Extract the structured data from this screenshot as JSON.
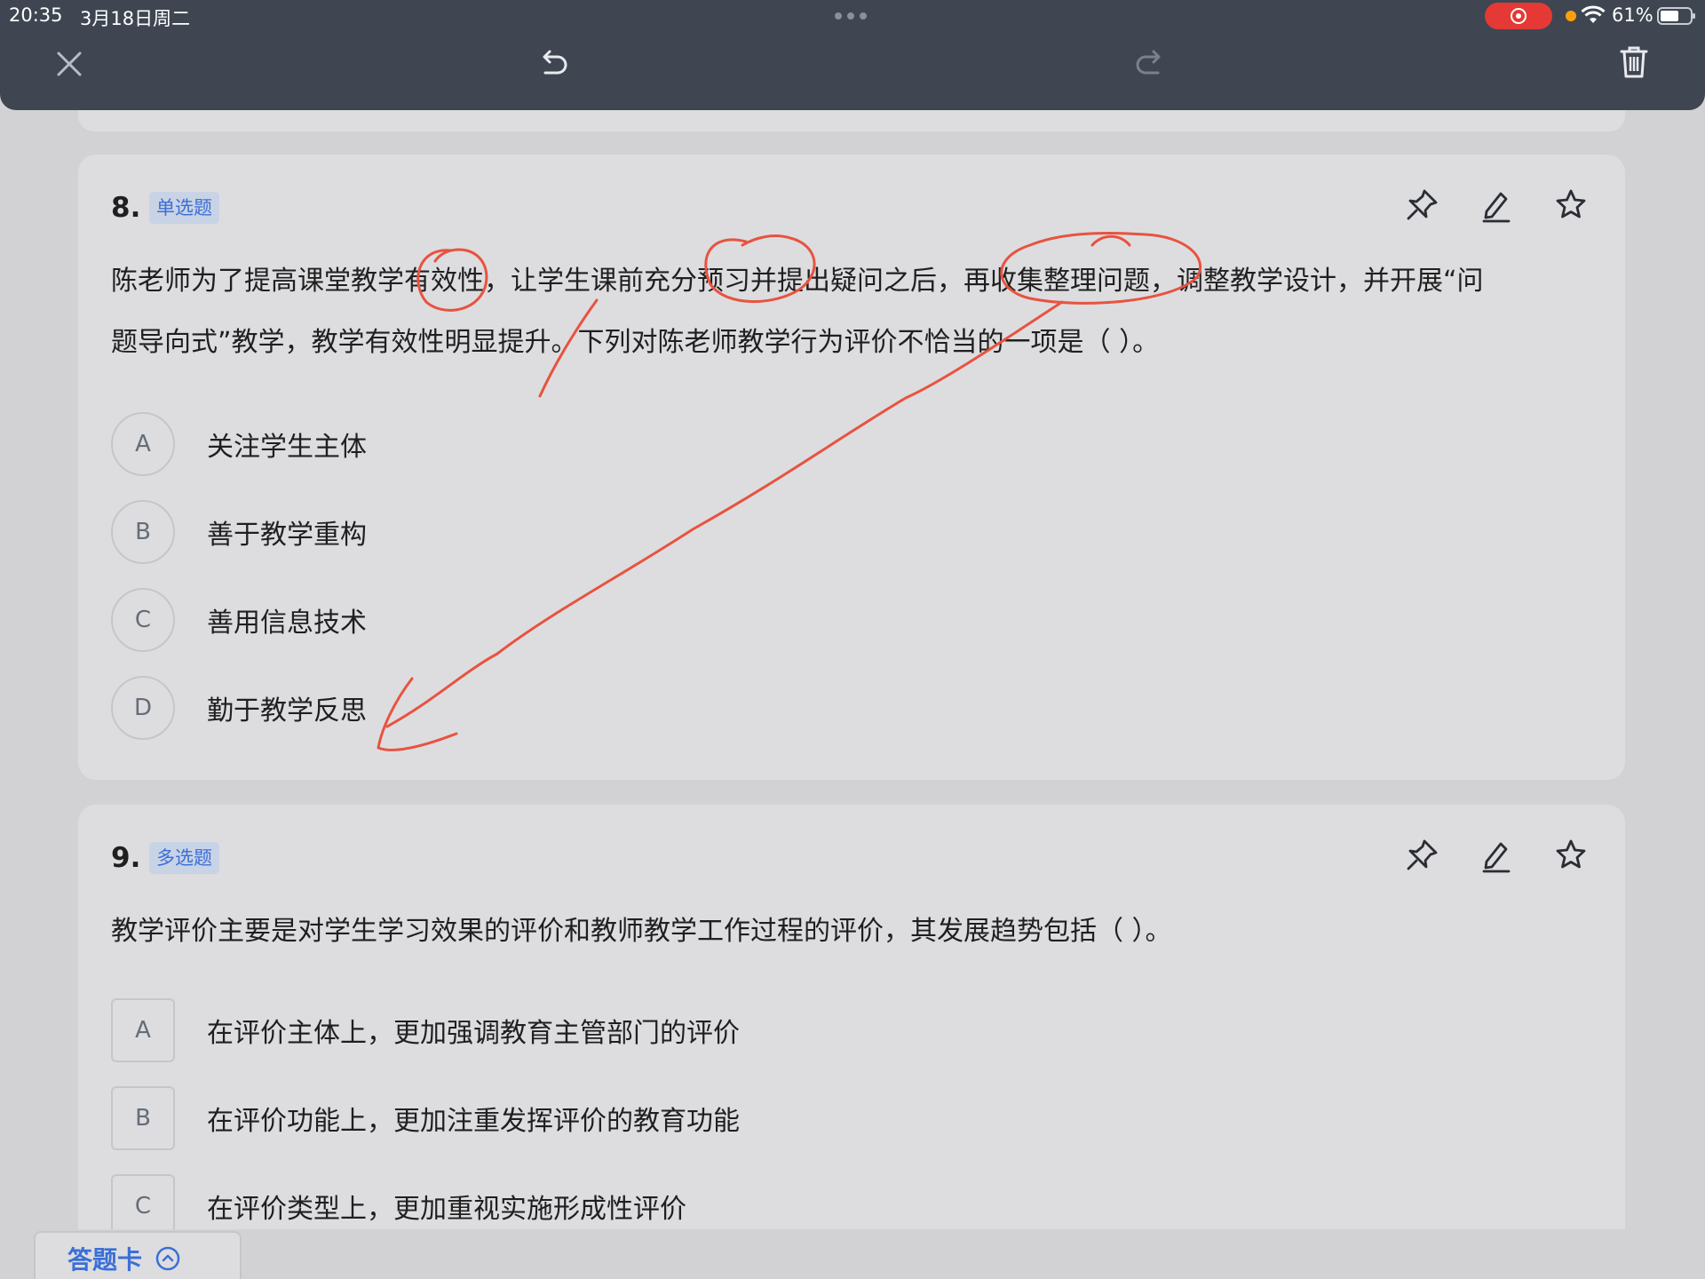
{
  "status_bar": {
    "time": "20:35",
    "date": "3月18日周二",
    "battery": "61%"
  },
  "toolbar": {
    "close_icon": "close-icon",
    "undo_icon": "undo-icon",
    "redo_icon": "redo-icon",
    "delete_icon": "trash-icon"
  },
  "questions": [
    {
      "number": "8.",
      "type": "单选题",
      "text_line1": "陈老师为了提高课堂教学有效性，让学生课前充分预习并提出疑问之后，再收集整理问题，调整教学设计，并开展“问",
      "text_line2": "题导向式”教学，教学有效性明显提升。下列对陈老师教学行为评价不恰当的一项是（   ）。",
      "options": [
        {
          "letter": "A",
          "text": "关注学生主体"
        },
        {
          "letter": "B",
          "text": "善于教学重构"
        },
        {
          "letter": "C",
          "text": "善用信息技术"
        },
        {
          "letter": "D",
          "text": "勤于教学反思"
        }
      ]
    },
    {
      "number": "9.",
      "type": "多选题",
      "text_line1": "教学评价主要是对学生学习效果的评价和教师教学工作过程的评价，其发展趋势包括（   ）。",
      "options": [
        {
          "letter": "A",
          "text": "在评价主体上，更加强调教育主管部门的评价"
        },
        {
          "letter": "B",
          "text": "在评价功能上，更加注重发挥评价的教育功能"
        },
        {
          "letter": "C",
          "text": "在评价类型上，更加重视实施形成性评价"
        }
      ]
    }
  ],
  "bottom": {
    "answer_card_label": "答题卡"
  },
  "colors": {
    "header_bg": "#3f4652",
    "accent_blue": "#3b6fd6",
    "annotation_red": "#e8533f",
    "record_red": "#e53935"
  }
}
